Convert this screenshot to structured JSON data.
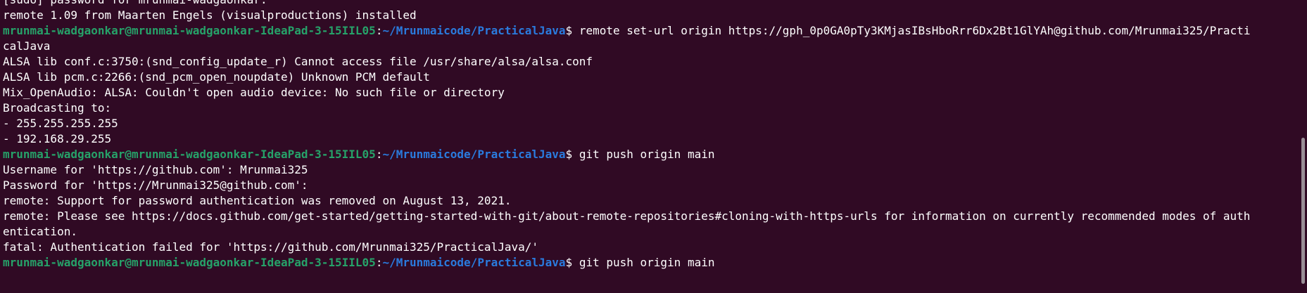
{
  "terminal": {
    "lines": [
      {
        "kind": "text",
        "text": "[sudo] password for mrunmai-wadgaonkar:"
      },
      {
        "kind": "text",
        "text": "remote 1.09 from Maarten Engels (visualproductions) installed"
      },
      {
        "kind": "prompt",
        "user": "mrunmai-wadgaonkar@mrunmai-wadgaonkar-IdeaPad-3-15IIL05",
        "path": "~/Mrunmaicode/PracticalJava",
        "command": "$ remote set-url origin https://gph_0p0GA0pTy3KMjasIBsHboRrr6Dx2Bt1GlYAh@github.com/Mrunmai325/Practi"
      },
      {
        "kind": "text",
        "text": "calJava"
      },
      {
        "kind": "text",
        "text": "ALSA lib conf.c:3750:(snd_config_update_r) Cannot access file /usr/share/alsa/alsa.conf"
      },
      {
        "kind": "text",
        "text": "ALSA lib pcm.c:2266:(snd_pcm_open_noupdate) Unknown PCM default"
      },
      {
        "kind": "text",
        "text": "Mix_OpenAudio: ALSA: Couldn't open audio device: No such file or directory"
      },
      {
        "kind": "text",
        "text": "Broadcasting to:"
      },
      {
        "kind": "text",
        "text": "- 255.255.255.255"
      },
      {
        "kind": "text",
        "text": "- 192.168.29.255"
      },
      {
        "kind": "prompt",
        "user": "mrunmai-wadgaonkar@mrunmai-wadgaonkar-IdeaPad-3-15IIL05",
        "path": "~/Mrunmaicode/PracticalJava",
        "command": "$ git push origin main"
      },
      {
        "kind": "text",
        "text": "Username for 'https://github.com': Mrunmai325"
      },
      {
        "kind": "text",
        "text": "Password for 'https://Mrunmai325@github.com':"
      },
      {
        "kind": "text",
        "text": "remote: Support for password authentication was removed on August 13, 2021."
      },
      {
        "kind": "text",
        "text": "remote: Please see https://docs.github.com/get-started/getting-started-with-git/about-remote-repositories#cloning-with-https-urls for information on currently recommended modes of auth"
      },
      {
        "kind": "text",
        "text": "entication."
      },
      {
        "kind": "text",
        "text": "fatal: Authentication failed for 'https://github.com/Mrunmai325/PracticalJava/'"
      },
      {
        "kind": "prompt",
        "user": "mrunmai-wadgaonkar@mrunmai-wadgaonkar-IdeaPad-3-15IIL05",
        "path": "~/Mrunmaicode/PracticalJava",
        "command": "$ git push origin main"
      }
    ]
  },
  "colors": {
    "background": "#300a24",
    "user": "#26a269",
    "path": "#2a7bde",
    "text": "#ffffff"
  }
}
